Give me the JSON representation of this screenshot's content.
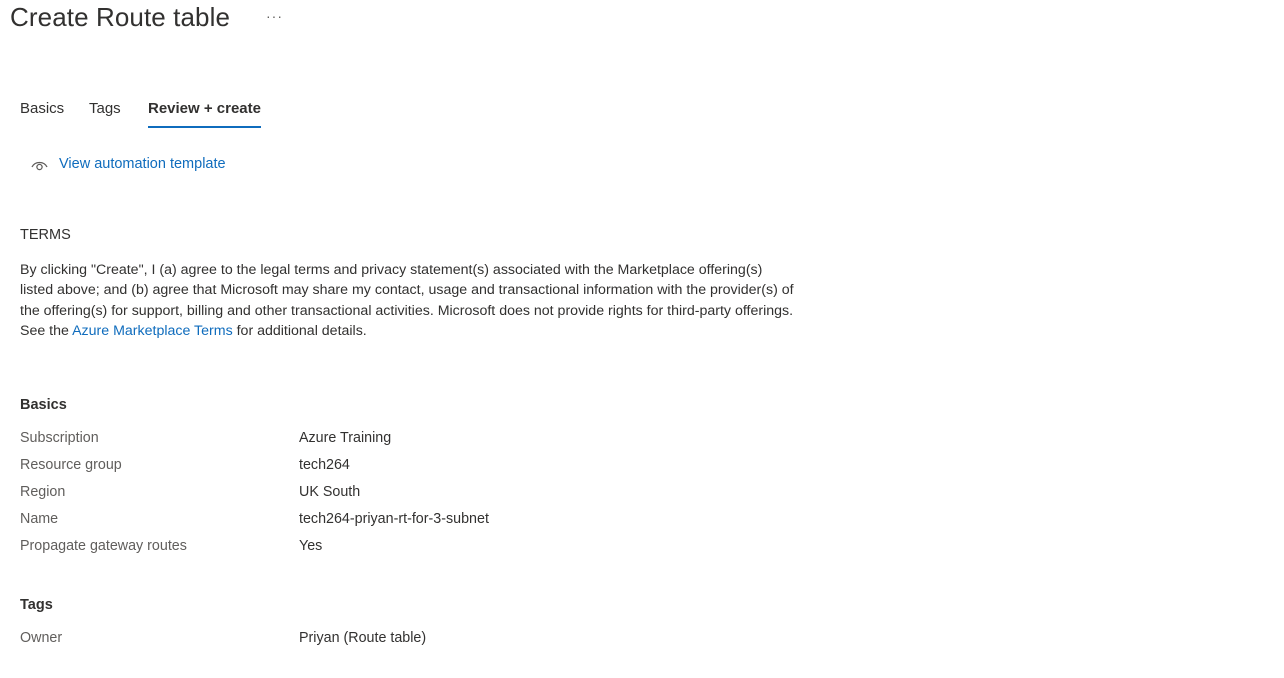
{
  "header": {
    "title": "Create Route table",
    "more_label": "···"
  },
  "tabs": [
    {
      "label": "Basics",
      "active": false
    },
    {
      "label": "Tags",
      "active": false
    },
    {
      "label": "Review + create",
      "active": true
    }
  ],
  "automation": {
    "icon": "eye-icon",
    "link_label": "View automation template"
  },
  "terms": {
    "heading": "TERMS",
    "text_before": "By clicking \"Create\", I (a) agree to the legal terms and privacy statement(s) associated with the Marketplace offering(s) listed above; and (b) agree that Microsoft may share my contact, usage and transactional information with the provider(s) of the offering(s) for support, billing and other transactional activities. Microsoft does not provide rights for third-party offerings. See the ",
    "link_label": "Azure Marketplace Terms",
    "text_after": " for additional details."
  },
  "basics": {
    "title": "Basics",
    "rows": [
      {
        "label": "Subscription",
        "value": "Azure Training"
      },
      {
        "label": "Resource group",
        "value": "tech264"
      },
      {
        "label": "Region",
        "value": "UK South"
      },
      {
        "label": "Name",
        "value": "tech264-priyan-rt-for-3-subnet"
      },
      {
        "label": "Propagate gateway routes",
        "value": "Yes"
      }
    ]
  },
  "tags": {
    "title": "Tags",
    "rows": [
      {
        "label": "Owner",
        "value": "Priyan (Route table)"
      }
    ]
  },
  "colors": {
    "accent": "#0f6cbd",
    "text": "#323130",
    "label": "#605e5c"
  }
}
